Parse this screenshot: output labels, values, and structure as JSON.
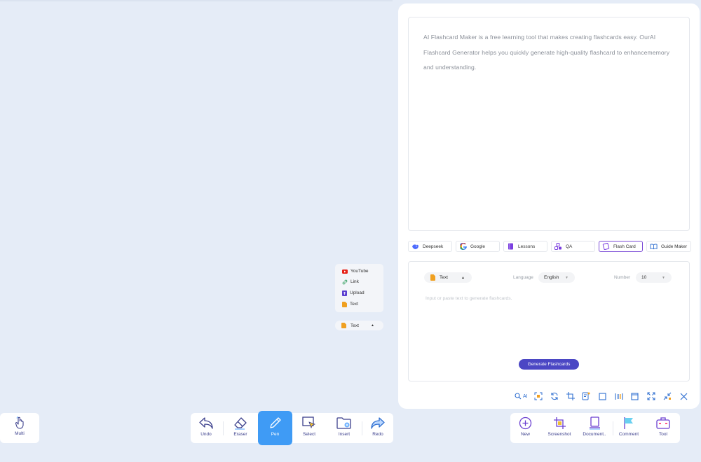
{
  "description": "AI Flashcard Maker is a free learning tool that makes creating flashcards easy. OurAI Flashcard Generator helps you quickly generate high-quality flashcard to enhancememory and understanding.",
  "tools": [
    {
      "label": "Deepseek"
    },
    {
      "label": "Google"
    },
    {
      "label": "Lessons"
    },
    {
      "label": "QA"
    },
    {
      "label": "Flash Card",
      "active": true
    },
    {
      "label": "Guide Maker"
    }
  ],
  "input_panel": {
    "source_type": "Text",
    "language_label": "Language",
    "language_value": "English",
    "number_label": "Number",
    "number_value": "10",
    "placeholder": "Input or paste text to generate flashcards.",
    "generate_label": "Generate Flashcards"
  },
  "panel_tools": {
    "ai_label": "AI"
  },
  "source_menu": {
    "items": [
      "YouTube",
      "Link",
      "Upload",
      "Text"
    ],
    "selected": "Text"
  },
  "toolbar_left": {
    "multi": "Multi"
  },
  "toolbar_center": {
    "undo": "Undo",
    "eraser": "Eraser",
    "pen": "Pen",
    "select": "Select",
    "insert": "Insert",
    "redo": "Redo"
  },
  "toolbar_right": {
    "new": "New",
    "screenshot": "Screenshot",
    "document": "Document..",
    "comment": "Comment",
    "tool": "Tool"
  },
  "colors": {
    "background": "#e5ecf7",
    "accent": "#4b47c4",
    "pen_active": "#3f9bf5",
    "flash_card_border": "#7b4bd6"
  }
}
